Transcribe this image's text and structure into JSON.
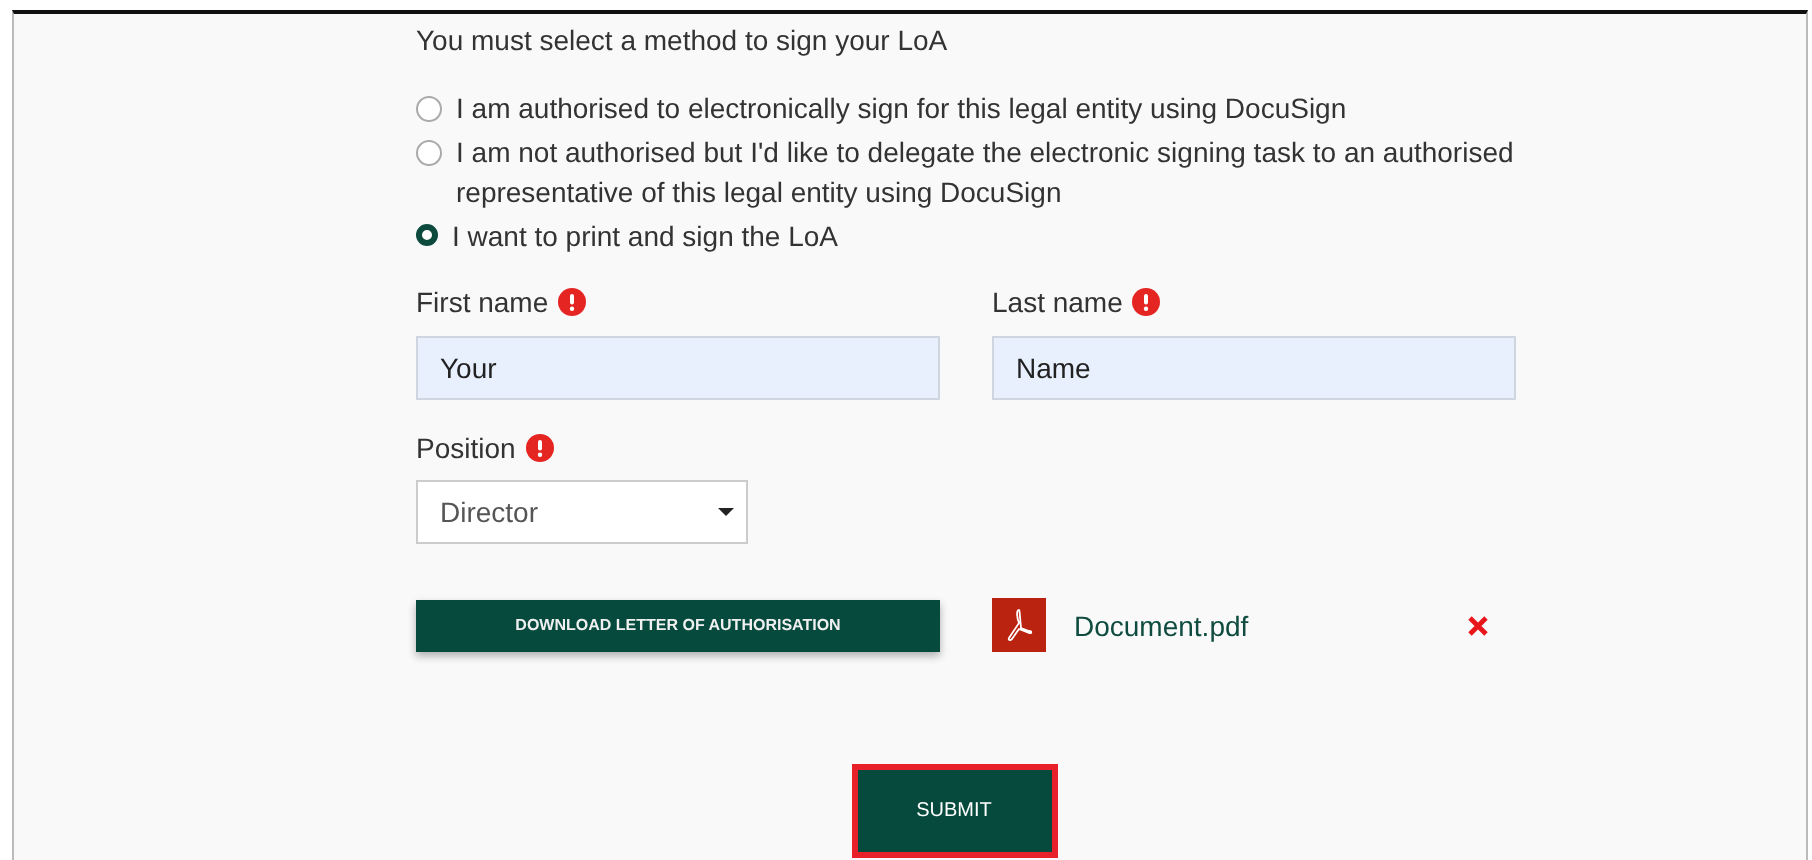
{
  "heading": "You must select a method to sign your LoA",
  "options": [
    {
      "label": "I am authorised to electronically sign for this legal entity using DocuSign",
      "selected": false
    },
    {
      "label": "I am not authorised but I'd like to delegate the electronic signing task to an authorised representative of this legal entity using DocuSign",
      "selected": false
    },
    {
      "label": "I want to print and sign the LoA",
      "selected": true
    }
  ],
  "fields": [
    {
      "label": "First name",
      "required": true,
      "value": "Your"
    },
    {
      "label": "Last name",
      "required": true,
      "value": "Name"
    }
  ],
  "position": {
    "label": "Position",
    "required": true,
    "value": "Director"
  },
  "download_button": "DOWNLOAD LETTER OF AUTHORISATION",
  "attachment": {
    "filename": "Document.pdf"
  },
  "submit": {
    "label": "SUBMIT",
    "highlighted": true
  }
}
